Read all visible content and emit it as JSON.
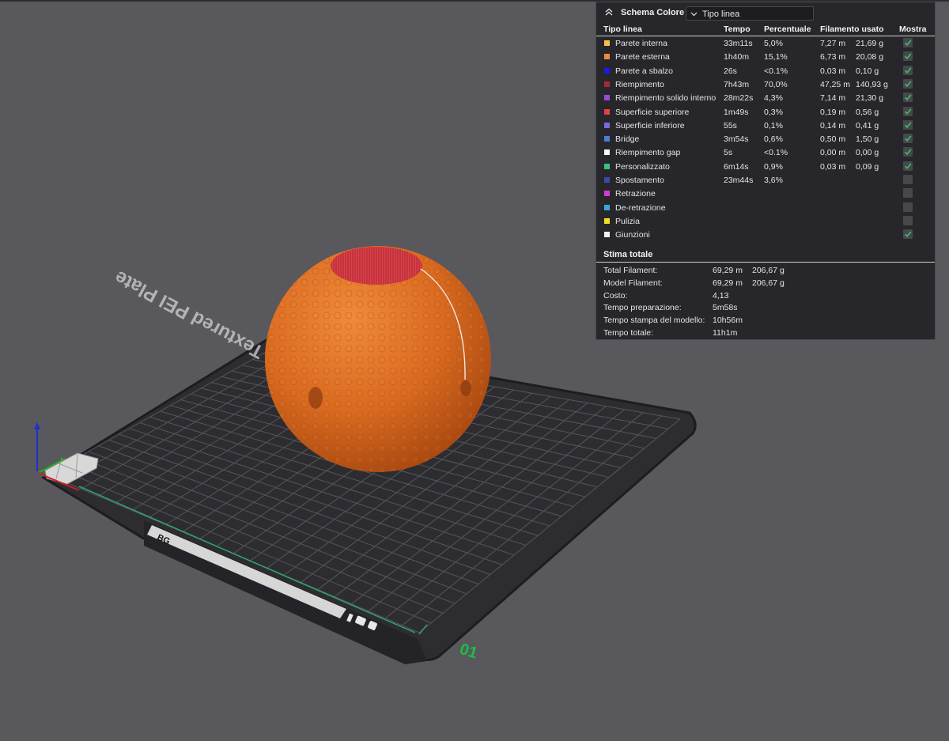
{
  "panel": {
    "title": "Schema Colore",
    "view_selector": "Tipo linea",
    "headers": {
      "type": "Tipo linea",
      "time": "Tempo",
      "percent": "Percentuale",
      "filament": "Filamento usato",
      "show": "Mostra"
    },
    "rows": [
      {
        "label": "Parete interna",
        "color": "#f5c344",
        "time": "33m11s",
        "percent": "5,0%",
        "length": "7,27 m",
        "weight": "21,69 g",
        "shown": true
      },
      {
        "label": "Parete esterna",
        "color": "#f08a3a",
        "time": "1h40m",
        "percent": "15,1%",
        "length": "6,73 m",
        "weight": "20,08 g",
        "shown": true
      },
      {
        "label": "Parete a sbalzo",
        "color": "#1a1ae0",
        "time": "26s",
        "percent": "<0.1%",
        "length": "0,03 m",
        "weight": "0,10 g",
        "shown": true
      },
      {
        "label": "Riempimento",
        "color": "#a8283a",
        "time": "7h43m",
        "percent": "70,0%",
        "length": "47,25 m",
        "weight": "140,93 g",
        "shown": true
      },
      {
        "label": "Riempimento solido interno",
        "color": "#9a4ad6",
        "time": "28m22s",
        "percent": "4,3%",
        "length": "7,14 m",
        "weight": "21,30 g",
        "shown": true
      },
      {
        "label": "Superficie superiore",
        "color": "#e5404a",
        "time": "1m49s",
        "percent": "0,3%",
        "length": "0,19 m",
        "weight": "0,56 g",
        "shown": true
      },
      {
        "label": "Superficie inferiore",
        "color": "#7a6ad6",
        "time": "55s",
        "percent": "0,1%",
        "length": "0,14 m",
        "weight": "0,41 g",
        "shown": true
      },
      {
        "label": "Bridge",
        "color": "#4a7ed6",
        "time": "3m54s",
        "percent": "0,6%",
        "length": "0,50 m",
        "weight": "1,50 g",
        "shown": true
      },
      {
        "label": "Riempimento gap",
        "color": "#f5f5f5",
        "time": "5s",
        "percent": "<0.1%",
        "length": "0,00 m",
        "weight": "0,00 g",
        "shown": true
      },
      {
        "label": "Personalizzato",
        "color": "#3cc07a",
        "time": "6m14s",
        "percent": "0,9%",
        "length": "0,03 m",
        "weight": "0,09 g",
        "shown": true
      },
      {
        "label": "Spostamento",
        "color": "#3a4aa6",
        "time": "23m44s",
        "percent": "3,6%",
        "length": "",
        "weight": "",
        "shown": false
      },
      {
        "label": "Retrazione",
        "color": "#d63ad6",
        "time": "",
        "percent": "",
        "length": "",
        "weight": "",
        "shown": false
      },
      {
        "label": "De-retrazione",
        "color": "#3aa8d6",
        "time": "",
        "percent": "",
        "length": "",
        "weight": "",
        "shown": false
      },
      {
        "label": "Pulizia",
        "color": "#f0e020",
        "time": "",
        "percent": "",
        "length": "",
        "weight": "",
        "shown": false
      },
      {
        "label": "Giunzioni",
        "color": "#f2f2f2",
        "time": "",
        "percent": "",
        "length": "",
        "weight": "",
        "shown": true
      }
    ],
    "estimate": {
      "title": "Stima totale",
      "rows": [
        {
          "label": "Total Filament:",
          "v1": "69,29 m",
          "v2": "206,67 g"
        },
        {
          "label": "Model Filament:",
          "v1": "69,29 m",
          "v2": "206,67 g"
        },
        {
          "label": "Costo:",
          "v1": "4,13",
          "v2": ""
        },
        {
          "label": "Tempo preparazione:",
          "v1": "5m58s",
          "v2": ""
        },
        {
          "label": "Tempo stampa del modello:",
          "v1": "10h56m",
          "v2": ""
        },
        {
          "label": "Tempo totale:",
          "v1": "11h1m",
          "v2": ""
        }
      ]
    }
  },
  "scene": {
    "plate_label": "Textured PEI Plate",
    "plate_number": "01",
    "sticker_brand": "BG",
    "colors": {
      "background": "#58585d",
      "bed": "#2b2b2f",
      "model": "#d7681f",
      "top_surface": "#c8323c",
      "plate_number": "#1dbf45",
      "axis_z": "#1f2fd0",
      "axis_x": "#d02020",
      "axis_y": "#20b020"
    }
  }
}
